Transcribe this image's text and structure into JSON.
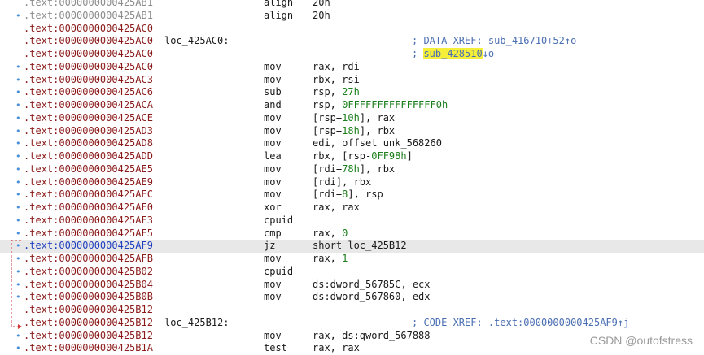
{
  "listing": [
    {
      "kind": "partial",
      "seg": ".text:",
      "off": "0000000000425AB1",
      "label": "",
      "mnem": "align",
      "ops": [
        [
          "20h",
          "plain"
        ]
      ],
      "cmt": "",
      "cmt_hl": "",
      "cmt_tail": ""
    },
    {
      "kind": "gray",
      "seg": ".text:",
      "off": "0000000000425AB1",
      "label": "",
      "mnem": "align",
      "ops": [
        [
          "20h",
          "plain"
        ]
      ],
      "cmt": "",
      "cmt_hl": "",
      "cmt_tail": ""
    },
    {
      "kind": "normal",
      "seg": ".text:",
      "off": "0000000000425AC0",
      "label": "",
      "mnem": "",
      "ops": [],
      "cmt": "",
      "cmt_hl": "",
      "cmt_tail": ""
    },
    {
      "kind": "normal",
      "seg": ".text:",
      "off": "0000000000425AC0",
      "label": "loc_425AC0:",
      "mnem": "",
      "ops": [],
      "cmt": "; DATA XREF: sub_416710+52↑o",
      "cmt_hl": "",
      "cmt_tail": ""
    },
    {
      "kind": "normal",
      "seg": ".text:",
      "off": "0000000000425AC0",
      "label": "",
      "mnem": "",
      "ops": [],
      "cmt": "; ",
      "cmt_hl": "sub_428510",
      "cmt_tail": "↓o"
    },
    {
      "kind": "normal",
      "seg": ".text:",
      "off": "0000000000425AC0",
      "label": "",
      "mnem": "mov",
      "ops": [
        [
          "rax, rdi",
          "plain"
        ]
      ],
      "cmt": "",
      "cmt_hl": "",
      "cmt_tail": ""
    },
    {
      "kind": "normal",
      "seg": ".text:",
      "off": "0000000000425AC3",
      "label": "",
      "mnem": "mov",
      "ops": [
        [
          "rbx, rsi",
          "plain"
        ]
      ],
      "cmt": "",
      "cmt_hl": "",
      "cmt_tail": ""
    },
    {
      "kind": "normal",
      "seg": ".text:",
      "off": "0000000000425AC6",
      "label": "",
      "mnem": "sub",
      "ops": [
        [
          "rsp, ",
          "plain"
        ],
        [
          "27h",
          "num"
        ]
      ],
      "cmt": "",
      "cmt_hl": "",
      "cmt_tail": ""
    },
    {
      "kind": "normal",
      "seg": ".text:",
      "off": "0000000000425ACA",
      "label": "",
      "mnem": "and",
      "ops": [
        [
          "rsp, ",
          "plain"
        ],
        [
          "0FFFFFFFFFFFFFFF0h",
          "num"
        ]
      ],
      "cmt": "",
      "cmt_hl": "",
      "cmt_tail": ""
    },
    {
      "kind": "normal",
      "seg": ".text:",
      "off": "0000000000425ACE",
      "label": "",
      "mnem": "mov",
      "ops": [
        [
          "[rsp+",
          "plain"
        ],
        [
          "10h",
          "num"
        ],
        [
          "], rax",
          "plain"
        ]
      ],
      "cmt": "",
      "cmt_hl": "",
      "cmt_tail": ""
    },
    {
      "kind": "normal",
      "seg": ".text:",
      "off": "0000000000425AD3",
      "label": "",
      "mnem": "mov",
      "ops": [
        [
          "[rsp+",
          "plain"
        ],
        [
          "18h",
          "num"
        ],
        [
          "], rbx",
          "plain"
        ]
      ],
      "cmt": "",
      "cmt_hl": "",
      "cmt_tail": ""
    },
    {
      "kind": "normal",
      "seg": ".text:",
      "off": "0000000000425AD8",
      "label": "",
      "mnem": "mov",
      "ops": [
        [
          "edi, offset unk_568260",
          "plain"
        ]
      ],
      "cmt": "",
      "cmt_hl": "",
      "cmt_tail": ""
    },
    {
      "kind": "normal",
      "seg": ".text:",
      "off": "0000000000425ADD",
      "label": "",
      "mnem": "lea",
      "ops": [
        [
          "rbx, [rsp-",
          "plain"
        ],
        [
          "0FF98h",
          "num"
        ],
        [
          "]",
          "plain"
        ]
      ],
      "cmt": "",
      "cmt_hl": "",
      "cmt_tail": ""
    },
    {
      "kind": "normal",
      "seg": ".text:",
      "off": "0000000000425AE5",
      "label": "",
      "mnem": "mov",
      "ops": [
        [
          "[rdi+",
          "plain"
        ],
        [
          "78h",
          "num"
        ],
        [
          "], rbx",
          "plain"
        ]
      ],
      "cmt": "",
      "cmt_hl": "",
      "cmt_tail": ""
    },
    {
      "kind": "normal",
      "seg": ".text:",
      "off": "0000000000425AE9",
      "label": "",
      "mnem": "mov",
      "ops": [
        [
          "[rdi], rbx",
          "plain"
        ]
      ],
      "cmt": "",
      "cmt_hl": "",
      "cmt_tail": ""
    },
    {
      "kind": "normal",
      "seg": ".text:",
      "off": "0000000000425AEC",
      "label": "",
      "mnem": "mov",
      "ops": [
        [
          "[rdi+",
          "plain"
        ],
        [
          "8",
          "num"
        ],
        [
          "], rsp",
          "plain"
        ]
      ],
      "cmt": "",
      "cmt_hl": "",
      "cmt_tail": ""
    },
    {
      "kind": "normal",
      "seg": ".text:",
      "off": "0000000000425AF0",
      "label": "",
      "mnem": "xor",
      "ops": [
        [
          "rax, rax",
          "plain"
        ]
      ],
      "cmt": "",
      "cmt_hl": "",
      "cmt_tail": ""
    },
    {
      "kind": "normal",
      "seg": ".text:",
      "off": "0000000000425AF3",
      "label": "",
      "mnem": "cpuid",
      "ops": [],
      "cmt": "",
      "cmt_hl": "",
      "cmt_tail": ""
    },
    {
      "kind": "normal",
      "seg": ".text:",
      "off": "0000000000425AF5",
      "label": "",
      "mnem": "cmp",
      "ops": [
        [
          "rax, ",
          "plain"
        ],
        [
          "0",
          "num"
        ]
      ],
      "cmt": "",
      "cmt_hl": "",
      "cmt_tail": ""
    },
    {
      "kind": "current",
      "seg": ".text:",
      "off": "0000000000425AF9",
      "label": "",
      "mnem": "jz",
      "ops": [
        [
          "short loc_425B12",
          "plain"
        ]
      ],
      "cmt": "",
      "cmt_hl": "",
      "cmt_tail": ""
    },
    {
      "kind": "normal",
      "seg": ".text:",
      "off": "0000000000425AFB",
      "label": "",
      "mnem": "mov",
      "ops": [
        [
          "rax, ",
          "plain"
        ],
        [
          "1",
          "num"
        ]
      ],
      "cmt": "",
      "cmt_hl": "",
      "cmt_tail": ""
    },
    {
      "kind": "normal",
      "seg": ".text:",
      "off": "0000000000425B02",
      "label": "",
      "mnem": "cpuid",
      "ops": [],
      "cmt": "",
      "cmt_hl": "",
      "cmt_tail": ""
    },
    {
      "kind": "normal",
      "seg": ".text:",
      "off": "0000000000425B04",
      "label": "",
      "mnem": "mov",
      "ops": [
        [
          "ds:dword_56785C, ecx",
          "plain"
        ]
      ],
      "cmt": "",
      "cmt_hl": "",
      "cmt_tail": ""
    },
    {
      "kind": "normal",
      "seg": ".text:",
      "off": "0000000000425B0B",
      "label": "",
      "mnem": "mov",
      "ops": [
        [
          "ds:dword_567860, edx",
          "plain"
        ]
      ],
      "cmt": "",
      "cmt_hl": "",
      "cmt_tail": ""
    },
    {
      "kind": "normal",
      "seg": ".text:",
      "off": "0000000000425B12",
      "label": "",
      "mnem": "",
      "ops": [],
      "cmt": "",
      "cmt_hl": "",
      "cmt_tail": ""
    },
    {
      "kind": "normal",
      "seg": ".text:",
      "off": "0000000000425B12",
      "label": "loc_425B12:",
      "mnem": "",
      "ops": [],
      "cmt": "; CODE XREF: .text:0000000000425AF9↑j",
      "cmt_hl": "",
      "cmt_tail": ""
    },
    {
      "kind": "normal",
      "seg": ".text:",
      "off": "0000000000425B12",
      "label": "",
      "mnem": "mov",
      "ops": [
        [
          "rax, ds:qword_567888",
          "plain"
        ]
      ],
      "cmt": "",
      "cmt_hl": "",
      "cmt_tail": ""
    },
    {
      "kind": "normal",
      "seg": ".text:",
      "off": "0000000000425B1A",
      "label": "",
      "mnem": "test",
      "ops": [
        [
          "rax, rax",
          "plain"
        ]
      ],
      "cmt": "",
      "cmt_hl": "",
      "cmt_tail": ""
    }
  ],
  "bullet_rows": [
    1,
    5,
    6,
    7,
    8,
    9,
    10,
    11,
    12,
    13,
    14,
    15,
    16,
    17,
    18,
    19,
    20,
    21,
    22,
    23,
    26,
    27
  ],
  "current_row": 19,
  "watermark": "CSDN @outofstress",
  "colors": {
    "segment": "#8b1a1a",
    "segment_current": "#1f3fbf",
    "segment_gray": "#8c8c8c",
    "comment": "#4b6fb3",
    "number": "#1a7f1a",
    "highlight": "#f5ef3a",
    "flow_arrow": "#d23c3c",
    "current_line_bg": "#e8e8e8"
  }
}
